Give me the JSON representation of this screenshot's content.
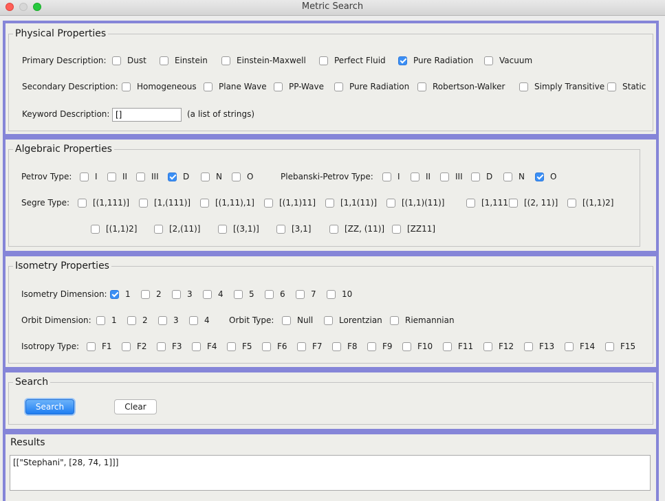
{
  "window": {
    "title": "Metric Search"
  },
  "physical": {
    "title": "Physical Properties",
    "primary": {
      "label": "Primary Description:",
      "options": [
        {
          "label": "Dust",
          "checked": false
        },
        {
          "label": "Einstein",
          "checked": false
        },
        {
          "label": "Einstein-Maxwell",
          "checked": false
        },
        {
          "label": "Perfect Fluid",
          "checked": false
        },
        {
          "label": "Pure Radiation",
          "checked": true
        },
        {
          "label": "Vacuum",
          "checked": false
        }
      ]
    },
    "secondary": {
      "label": "Secondary Description:",
      "options": [
        {
          "label": "Homogeneous",
          "checked": false
        },
        {
          "label": "Plane Wave",
          "checked": false
        },
        {
          "label": "PP-Wave",
          "checked": false
        },
        {
          "label": "Pure Radiation",
          "checked": false
        },
        {
          "label": "Robertson-Walker",
          "checked": false
        },
        {
          "label": "Simply Transitive",
          "checked": false
        },
        {
          "label": "Static",
          "checked": false
        }
      ]
    },
    "keyword": {
      "label": "Keyword Description:",
      "value": "[]",
      "hint": "(a list of strings)"
    }
  },
  "algebraic": {
    "title": "Algebraic Properties",
    "petrov": {
      "label": "Petrov Type:",
      "options": [
        {
          "label": "I",
          "checked": false
        },
        {
          "label": "II",
          "checked": false
        },
        {
          "label": "III",
          "checked": false
        },
        {
          "label": "D",
          "checked": true
        },
        {
          "label": "N",
          "checked": false
        },
        {
          "label": "O",
          "checked": false
        }
      ]
    },
    "plebanski": {
      "label": "Plebanski-Petrov Type:",
      "options": [
        {
          "label": "I",
          "checked": false
        },
        {
          "label": "II",
          "checked": false
        },
        {
          "label": "III",
          "checked": false
        },
        {
          "label": "D",
          "checked": false
        },
        {
          "label": "N",
          "checked": false
        },
        {
          "label": "O",
          "checked": true
        }
      ]
    },
    "segre": {
      "label": "Segre Type:",
      "row1": [
        {
          "label": "[(1,111)]",
          "checked": false
        },
        {
          "label": "[1,(111)]",
          "checked": false
        },
        {
          "label": "[(1,11),1]",
          "checked": false
        },
        {
          "label": "[(1,1)11]",
          "checked": false
        },
        {
          "label": "[1,1(11)]",
          "checked": false
        },
        {
          "label": "[(1,1)(11)]",
          "checked": false
        },
        {
          "label": "[1,111]",
          "checked": false
        },
        {
          "label": "[(2, 11)]",
          "checked": false
        },
        {
          "label": "[(1,1)2]",
          "checked": false
        }
      ],
      "row2": [
        {
          "label": "[(1,1)2]",
          "checked": false
        },
        {
          "label": "[2,(11)]",
          "checked": false
        },
        {
          "label": "[(3,1)]",
          "checked": false
        },
        {
          "label": "[3,1]",
          "checked": false
        },
        {
          "label": "[ZZ, (11)]",
          "checked": false
        },
        {
          "label": "[ZZ11]",
          "checked": false
        }
      ]
    }
  },
  "isometry": {
    "title": "Isometry Properties",
    "dimension": {
      "label": "Isometry Dimension:",
      "options": [
        {
          "label": "1",
          "checked": true
        },
        {
          "label": "2",
          "checked": false
        },
        {
          "label": "3",
          "checked": false
        },
        {
          "label": "4",
          "checked": false
        },
        {
          "label": "5",
          "checked": false
        },
        {
          "label": "6",
          "checked": false
        },
        {
          "label": "7",
          "checked": false
        },
        {
          "label": "10",
          "checked": false
        }
      ]
    },
    "orbit_dim": {
      "label": "Orbit Dimension:",
      "options": [
        {
          "label": "1",
          "checked": false
        },
        {
          "label": "2",
          "checked": false
        },
        {
          "label": "3",
          "checked": false
        },
        {
          "label": "4",
          "checked": false
        }
      ]
    },
    "orbit_type": {
      "label": "Orbit Type:",
      "options": [
        {
          "label": "Null",
          "checked": false
        },
        {
          "label": "Lorentzian",
          "checked": false
        },
        {
          "label": "Riemannian",
          "checked": false
        }
      ]
    },
    "isotropy": {
      "label": "Isotropy Type:",
      "options": [
        {
          "label": "F1",
          "checked": false
        },
        {
          "label": "F2",
          "checked": false
        },
        {
          "label": "F3",
          "checked": false
        },
        {
          "label": "F4",
          "checked": false
        },
        {
          "label": "F5",
          "checked": false
        },
        {
          "label": "F6",
          "checked": false
        },
        {
          "label": "F7",
          "checked": false
        },
        {
          "label": "F8",
          "checked": false
        },
        {
          "label": "F9",
          "checked": false
        },
        {
          "label": "F10",
          "checked": false
        },
        {
          "label": "F11",
          "checked": false
        },
        {
          "label": "F12",
          "checked": false
        },
        {
          "label": "F13",
          "checked": false
        },
        {
          "label": "F14",
          "checked": false
        },
        {
          "label": "F15",
          "checked": false
        }
      ]
    }
  },
  "search": {
    "title": "Search",
    "search_label": "Search",
    "clear_label": "Clear"
  },
  "results": {
    "title": "Results",
    "text": "[[\"Stephani\", [28, 74, 1]]]"
  },
  "colors": {
    "panel_border": "#8585d8",
    "accent": "#3b8ff5"
  }
}
